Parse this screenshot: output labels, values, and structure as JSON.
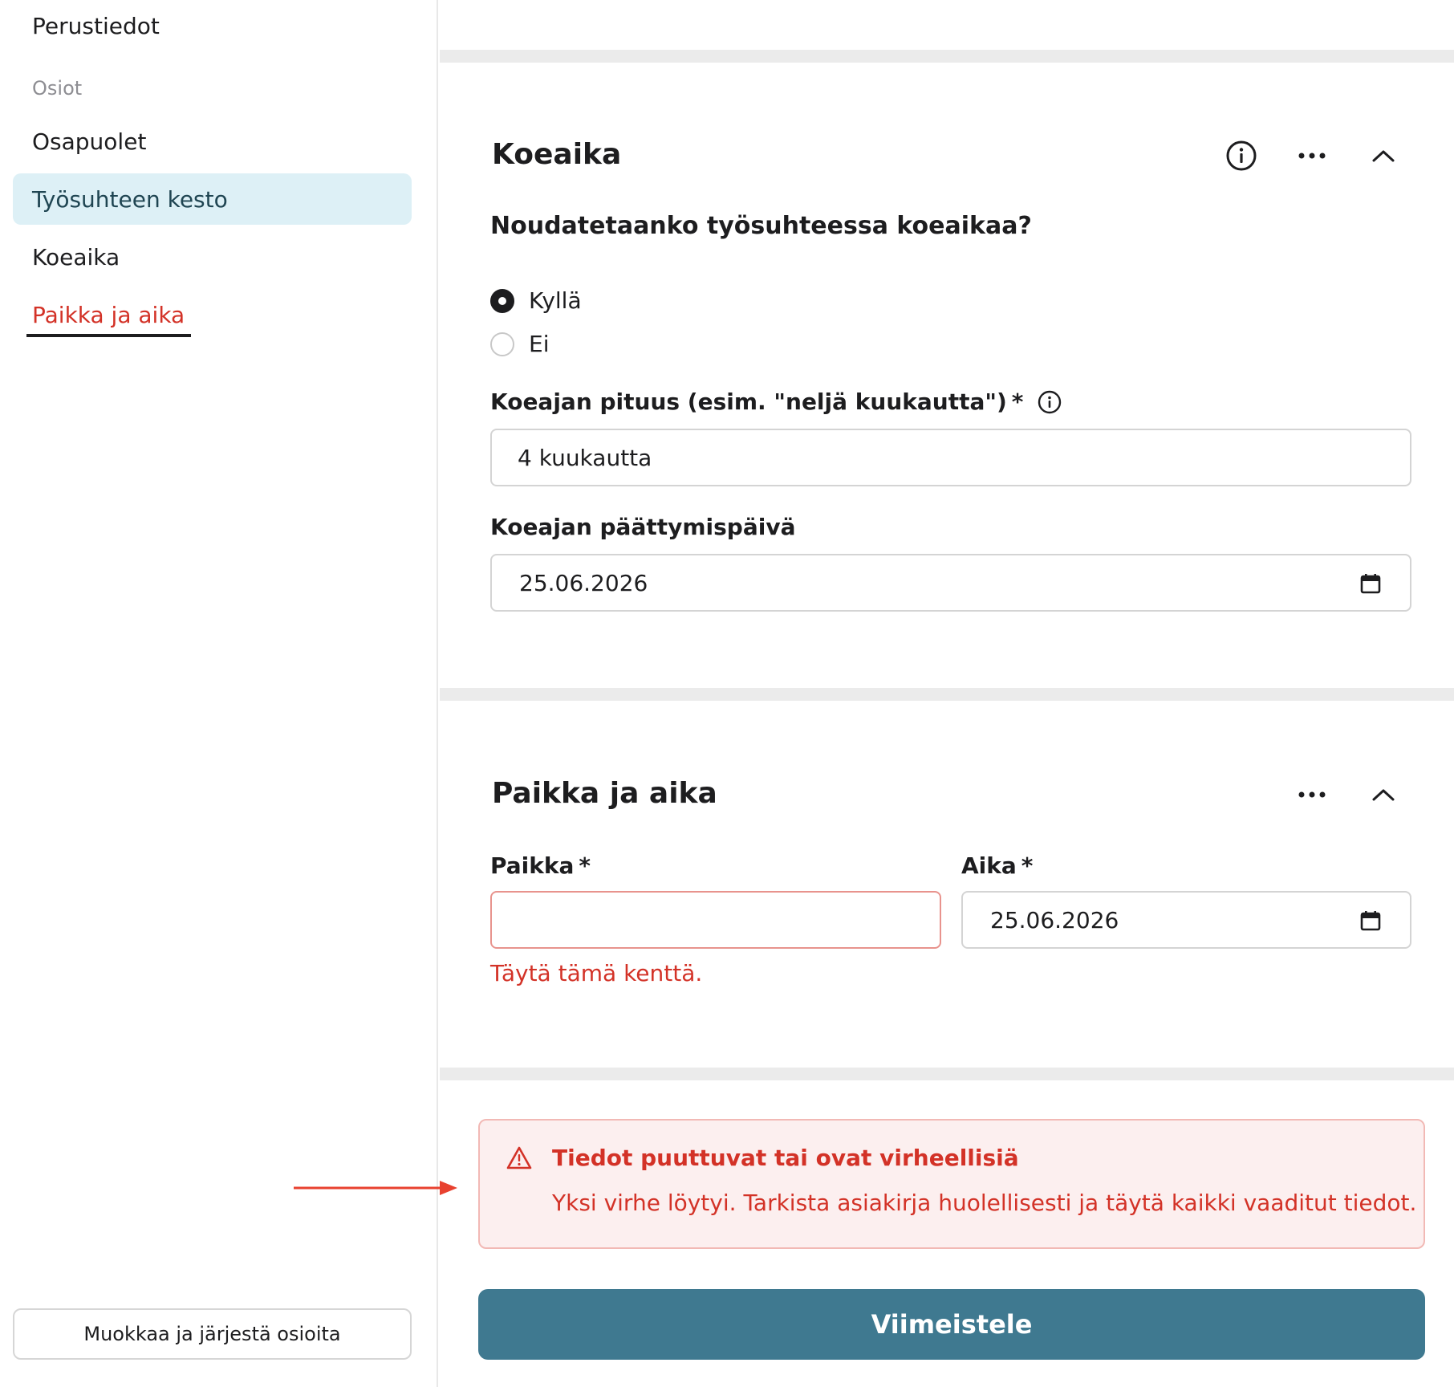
{
  "sidebar": {
    "items": [
      {
        "label": "Perustiedot"
      },
      {
        "label": "Osapuolet"
      },
      {
        "label": "Työsuhteen kesto"
      },
      {
        "label": "Koeaika"
      },
      {
        "label": "Paikka ja aika"
      }
    ],
    "section_heading": "Osiot",
    "edit_button_label": "Muokkaa ja järjestä osioita"
  },
  "koeaika": {
    "title": "Koeaika",
    "question": "Noudatetaanko työsuhteessa koeaikaa?",
    "options": [
      {
        "label": "Kyllä",
        "selected": true
      },
      {
        "label": "Ei",
        "selected": false
      }
    ],
    "length_label": "Koeajan pituus (esim. \"neljä kuukautta\")",
    "length_value": "4 kuukautta",
    "end_label": "Koeajan päättymispäivä",
    "end_value": "25.06.2026"
  },
  "paikka": {
    "title": "Paikka ja aika",
    "place_label": "Paikka",
    "place_value": "",
    "place_error": "Täytä tämä kenttä.",
    "time_label": "Aika",
    "time_value": "25.06.2026"
  },
  "required_marker": "*",
  "error_banner": {
    "title": "Tiedot puuttuvat tai ovat virheellisiä",
    "message": "Yksi virhe löytyi. Tarkista asiakirja huolellisesti ja täytä kaikki vaaditut tiedot."
  },
  "finish_button_label": "Viimeistele",
  "colors": {
    "accent": "#3f7990",
    "active_nav_bg": "#ddf0f6",
    "error": "#d33227",
    "error_bg": "#fcefef"
  },
  "icons": [
    "info-icon",
    "more-icon",
    "chevron-up-icon",
    "calendar-icon",
    "warning-icon",
    "arrow-right-icon"
  ]
}
